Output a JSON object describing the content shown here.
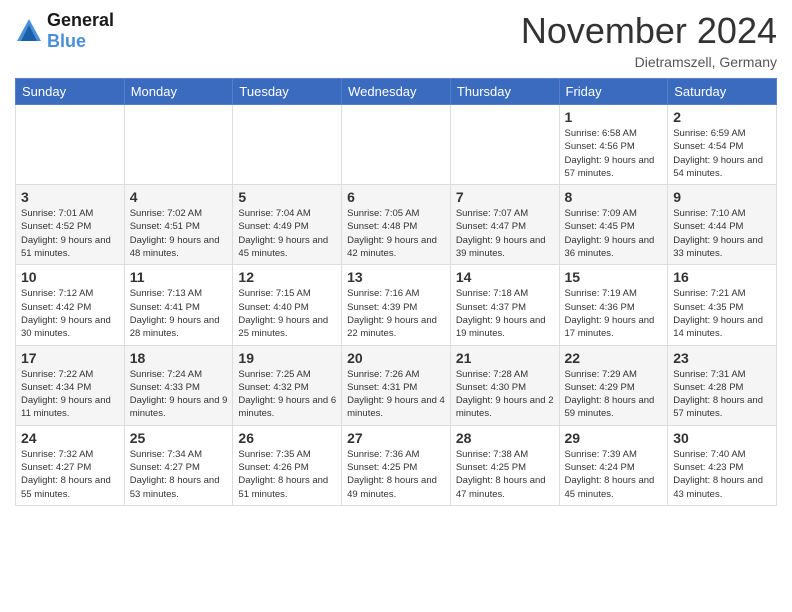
{
  "header": {
    "logo_line1": "General",
    "logo_line2": "Blue",
    "month_title": "November 2024",
    "location": "Dietramszell, Germany"
  },
  "days_of_week": [
    "Sunday",
    "Monday",
    "Tuesday",
    "Wednesday",
    "Thursday",
    "Friday",
    "Saturday"
  ],
  "weeks": [
    [
      {
        "day": "",
        "info": ""
      },
      {
        "day": "",
        "info": ""
      },
      {
        "day": "",
        "info": ""
      },
      {
        "day": "",
        "info": ""
      },
      {
        "day": "",
        "info": ""
      },
      {
        "day": "1",
        "info": "Sunrise: 6:58 AM\nSunset: 4:56 PM\nDaylight: 9 hours and 57 minutes."
      },
      {
        "day": "2",
        "info": "Sunrise: 6:59 AM\nSunset: 4:54 PM\nDaylight: 9 hours and 54 minutes."
      }
    ],
    [
      {
        "day": "3",
        "info": "Sunrise: 7:01 AM\nSunset: 4:52 PM\nDaylight: 9 hours and 51 minutes."
      },
      {
        "day": "4",
        "info": "Sunrise: 7:02 AM\nSunset: 4:51 PM\nDaylight: 9 hours and 48 minutes."
      },
      {
        "day": "5",
        "info": "Sunrise: 7:04 AM\nSunset: 4:49 PM\nDaylight: 9 hours and 45 minutes."
      },
      {
        "day": "6",
        "info": "Sunrise: 7:05 AM\nSunset: 4:48 PM\nDaylight: 9 hours and 42 minutes."
      },
      {
        "day": "7",
        "info": "Sunrise: 7:07 AM\nSunset: 4:47 PM\nDaylight: 9 hours and 39 minutes."
      },
      {
        "day": "8",
        "info": "Sunrise: 7:09 AM\nSunset: 4:45 PM\nDaylight: 9 hours and 36 minutes."
      },
      {
        "day": "9",
        "info": "Sunrise: 7:10 AM\nSunset: 4:44 PM\nDaylight: 9 hours and 33 minutes."
      }
    ],
    [
      {
        "day": "10",
        "info": "Sunrise: 7:12 AM\nSunset: 4:42 PM\nDaylight: 9 hours and 30 minutes."
      },
      {
        "day": "11",
        "info": "Sunrise: 7:13 AM\nSunset: 4:41 PM\nDaylight: 9 hours and 28 minutes."
      },
      {
        "day": "12",
        "info": "Sunrise: 7:15 AM\nSunset: 4:40 PM\nDaylight: 9 hours and 25 minutes."
      },
      {
        "day": "13",
        "info": "Sunrise: 7:16 AM\nSunset: 4:39 PM\nDaylight: 9 hours and 22 minutes."
      },
      {
        "day": "14",
        "info": "Sunrise: 7:18 AM\nSunset: 4:37 PM\nDaylight: 9 hours and 19 minutes."
      },
      {
        "day": "15",
        "info": "Sunrise: 7:19 AM\nSunset: 4:36 PM\nDaylight: 9 hours and 17 minutes."
      },
      {
        "day": "16",
        "info": "Sunrise: 7:21 AM\nSunset: 4:35 PM\nDaylight: 9 hours and 14 minutes."
      }
    ],
    [
      {
        "day": "17",
        "info": "Sunrise: 7:22 AM\nSunset: 4:34 PM\nDaylight: 9 hours and 11 minutes."
      },
      {
        "day": "18",
        "info": "Sunrise: 7:24 AM\nSunset: 4:33 PM\nDaylight: 9 hours and 9 minutes."
      },
      {
        "day": "19",
        "info": "Sunrise: 7:25 AM\nSunset: 4:32 PM\nDaylight: 9 hours and 6 minutes."
      },
      {
        "day": "20",
        "info": "Sunrise: 7:26 AM\nSunset: 4:31 PM\nDaylight: 9 hours and 4 minutes."
      },
      {
        "day": "21",
        "info": "Sunrise: 7:28 AM\nSunset: 4:30 PM\nDaylight: 9 hours and 2 minutes."
      },
      {
        "day": "22",
        "info": "Sunrise: 7:29 AM\nSunset: 4:29 PM\nDaylight: 8 hours and 59 minutes."
      },
      {
        "day": "23",
        "info": "Sunrise: 7:31 AM\nSunset: 4:28 PM\nDaylight: 8 hours and 57 minutes."
      }
    ],
    [
      {
        "day": "24",
        "info": "Sunrise: 7:32 AM\nSunset: 4:27 PM\nDaylight: 8 hours and 55 minutes."
      },
      {
        "day": "25",
        "info": "Sunrise: 7:34 AM\nSunset: 4:27 PM\nDaylight: 8 hours and 53 minutes."
      },
      {
        "day": "26",
        "info": "Sunrise: 7:35 AM\nSunset: 4:26 PM\nDaylight: 8 hours and 51 minutes."
      },
      {
        "day": "27",
        "info": "Sunrise: 7:36 AM\nSunset: 4:25 PM\nDaylight: 8 hours and 49 minutes."
      },
      {
        "day": "28",
        "info": "Sunrise: 7:38 AM\nSunset: 4:25 PM\nDaylight: 8 hours and 47 minutes."
      },
      {
        "day": "29",
        "info": "Sunrise: 7:39 AM\nSunset: 4:24 PM\nDaylight: 8 hours and 45 minutes."
      },
      {
        "day": "30",
        "info": "Sunrise: 7:40 AM\nSunset: 4:23 PM\nDaylight: 8 hours and 43 minutes."
      }
    ]
  ]
}
